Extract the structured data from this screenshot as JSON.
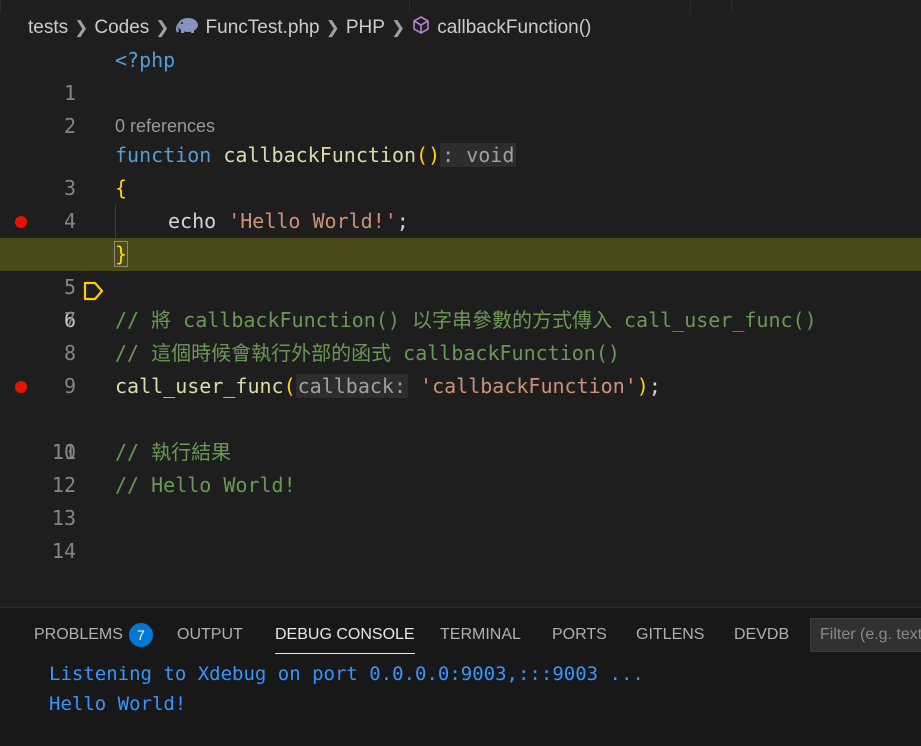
{
  "breadcrumb": {
    "items": [
      "tests",
      "Codes",
      "FuncTest.php",
      "PHP",
      "callbackFunction()"
    ],
    "file_icon": "elephant-php-icon",
    "symbol_icon": "method-cube-icon"
  },
  "editor": {
    "current_line": 6,
    "codelens": "0 references",
    "lines": [
      {
        "n": "1"
      },
      {
        "n": "2"
      },
      {
        "n": "3"
      },
      {
        "n": "4"
      },
      {
        "n": "5"
      },
      {
        "n": "6"
      },
      {
        "n": "7"
      },
      {
        "n": "8"
      },
      {
        "n": "9"
      },
      {
        "n": "10"
      },
      {
        "n": "11"
      },
      {
        "n": "12"
      },
      {
        "n": "13"
      },
      {
        "n": "14"
      }
    ],
    "tokens": {
      "php_open": "<?php",
      "kw_function": "function",
      "fn_name": "callbackFunction",
      "parens": "()",
      "return_hint": ": void",
      "brace_open": "{",
      "echo": "echo",
      "hello_str": "'Hello World!'",
      "semicolon": ";",
      "brace_close": "}",
      "comment8": "// 將 callbackFunction() 以字串參數的方式傳入 call_user_func()",
      "comment9": "// 這個時候會執行外部的函式 callbackFunction()",
      "call_fn": "call_user_func",
      "paren_open": "(",
      "param_hint": "callback:",
      "cb_str": "'callbackFunction'",
      "paren_close": ")",
      "end_semicolon": ";",
      "comment12": "// 執行結果",
      "comment13": "// Hello World!"
    },
    "breakpoints": [
      5,
      10
    ],
    "colors": {
      "background": "#1e1e1e",
      "current_line_highlight": "#4b4b18",
      "breakpoint": "#e51400",
      "stack_frame": "#ffcc00"
    }
  },
  "panel": {
    "tabs": {
      "problems": "PROBLEMS",
      "problems_count": "7",
      "output": "OUTPUT",
      "debug_console": "DEBUG CONSOLE",
      "terminal": "TERMINAL",
      "ports": "PORTS",
      "gitlens": "GITLENS",
      "devdb": "DEVDB"
    },
    "active_tab": "DEBUG CONSOLE",
    "filter_placeholder": "Filter (e.g. text",
    "console": [
      "Listening to Xdebug on port 0.0.0.0:9003,:::9003 ...",
      "Hello World!"
    ]
  }
}
